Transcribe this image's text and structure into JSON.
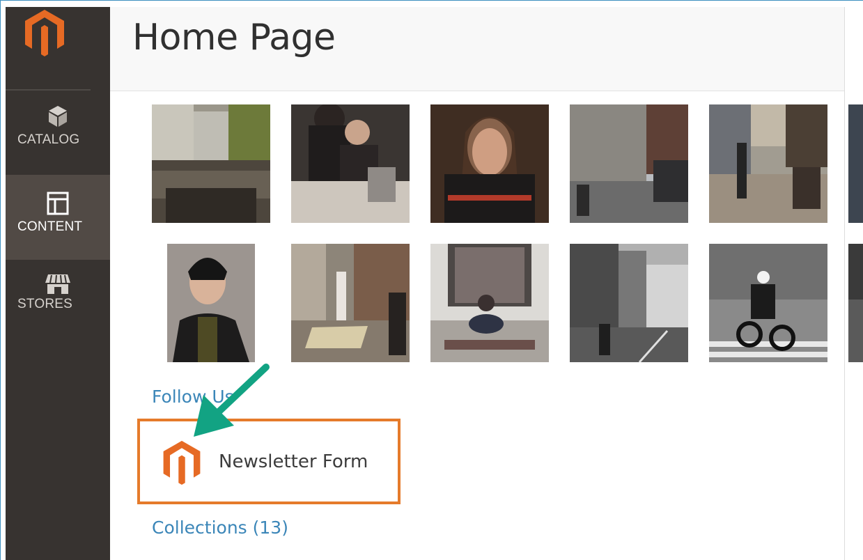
{
  "header": {
    "title": "Home Page"
  },
  "sidebar": {
    "items": [
      {
        "label": "CATALOG",
        "icon": "cube-icon"
      },
      {
        "label": "CONTENT",
        "icon": "layout-icon",
        "active": true
      },
      {
        "label": "STORES",
        "icon": "storefront-icon"
      }
    ]
  },
  "content": {
    "follow_link": "Follow Us",
    "widget_label": "Newsletter Form",
    "collections_link": "Collections (13)"
  },
  "colors": {
    "sidebar_bg": "#373330",
    "sidebar_active": "#514a45",
    "brand_orange": "#e57b2b",
    "link_blue": "#3b86b8",
    "arrow_green": "#12a383"
  }
}
